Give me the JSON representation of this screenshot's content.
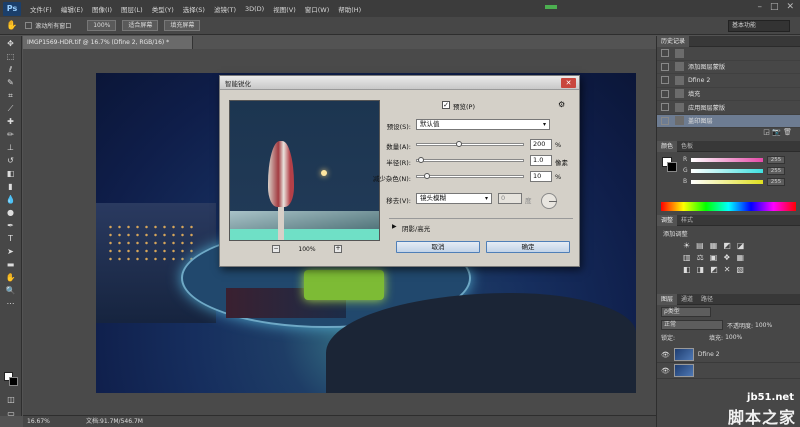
{
  "app": {
    "logo": "Ps",
    "menu": [
      "文件(F)",
      "编辑(E)",
      "图像(I)",
      "图层(L)",
      "类型(Y)",
      "选择(S)",
      "滤镜(T)",
      "3D(D)",
      "视图(V)",
      "窗口(W)",
      "帮助(H)"
    ],
    "window_controls": [
      "–",
      "□",
      "✕"
    ]
  },
  "options": {
    "checkbox_label": "滚动所有窗口",
    "btn_100": "100%",
    "btn_fit": "适合屏幕",
    "btn_fill": "填充屏幕",
    "workspace": "基本功能"
  },
  "document": {
    "tab_title": "IMGP1569-HDR.tif @ 16.7% (Dfine 2, RGB/16) *",
    "zoom": "16.67%",
    "file_info": "文档:91.7M/546.7M"
  },
  "panels": {
    "history": {
      "tabs": [
        "历史记录"
      ],
      "items": [
        "",
        "添加图层蒙版",
        "Dfine 2",
        "填充",
        "应用图层蒙版",
        "盖印图层"
      ],
      "selected_index": 5
    },
    "color": {
      "tabs": [
        "颜色",
        "色板"
      ],
      "channels": [
        {
          "letter": "R",
          "value": "255",
          "color": "#e44aa8"
        },
        {
          "letter": "G",
          "value": "255",
          "color": "#3fe0e0"
        },
        {
          "letter": "B",
          "value": "255",
          "color": "#e0e020"
        }
      ]
    },
    "adjustments": {
      "tabs": [
        "调整",
        "样式"
      ],
      "heading": "添加调整",
      "row1": [
        "☀",
        "▤",
        "▦",
        "◩",
        "◪"
      ],
      "row2": [
        "▥",
        "⚖",
        "▣",
        "❖",
        "▦"
      ],
      "row3": [
        "◧",
        "◨",
        "◩",
        "✕",
        "▧"
      ]
    },
    "layers": {
      "tabs": [
        "图层",
        "通道",
        "路径"
      ],
      "filter": "ρ类型",
      "blend": "正常",
      "opacity_label": "不透明度:",
      "opacity": "100%",
      "lock_label": "锁定:",
      "fill_label": "填充:",
      "fill": "100%",
      "items": [
        "Dfine 2"
      ]
    }
  },
  "dialog": {
    "title": "智能锐化",
    "preview_label": "预览(P)",
    "preview_checked": true,
    "preset_label": "预设(S):",
    "preset_value": "默认值",
    "amount_label": "数量(A):",
    "amount": "200",
    "amount_unit": "%",
    "amount_fraction": 0.4,
    "radius_label": "半径(R):",
    "radius": "1.0",
    "radius_unit": "像素",
    "radius_fraction": 0.05,
    "noise_label": "减少杂色(N):",
    "noise": "10",
    "noise_unit": "%",
    "noise_fraction": 0.1,
    "remove_label": "移去(V):",
    "remove_value": "镜头模糊",
    "angle": "0",
    "angle_unit": "度",
    "shadows_label": "阴影/高光",
    "preview_zoom": "100%",
    "cancel": "取消",
    "ok": "确定"
  },
  "watermark": {
    "url": "jb51.net",
    "name": "脚本之家"
  }
}
